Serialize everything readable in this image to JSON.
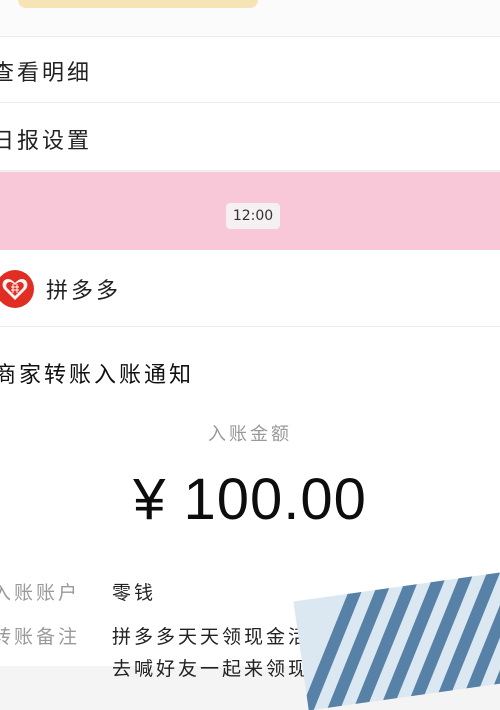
{
  "menu": {
    "view_details": "查看明细",
    "daily_report_settings": "日报设置"
  },
  "chat": {
    "timestamp": "12:00"
  },
  "merchant": {
    "name": "拼多多",
    "logo_icon": "pinduoduo-logo-icon"
  },
  "notification": {
    "title": "商家转账入账通知",
    "amount_label": "入账金额",
    "amount": "¥ 100.00",
    "account_label": "入账账户",
    "account_value": "零钱",
    "remark_label": "转账备注",
    "remark_value": "拼多多天天领现金活",
    "remark_value_line2": "去喊好友一起来领现金吧~"
  },
  "colors": {
    "pink_bg": "#f8c7d8",
    "logo_red": "#e02e24",
    "label_gray": "#9a9a9a"
  }
}
